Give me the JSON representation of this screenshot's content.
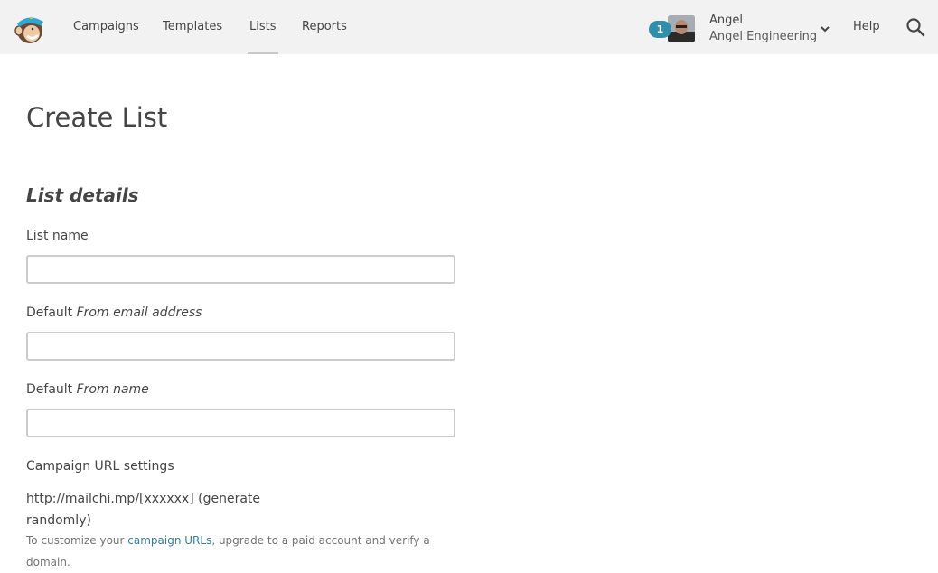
{
  "header": {
    "logo": "mailchimp-freddie-logo",
    "nav": [
      {
        "label": "Campaigns",
        "active": false
      },
      {
        "label": "Templates",
        "active": false
      },
      {
        "label": "Lists",
        "active": true
      },
      {
        "label": "Reports",
        "active": false
      }
    ],
    "notification_count": "1",
    "user": {
      "name": "Angel",
      "organization": "Angel Engineering"
    },
    "help_label": "Help",
    "icons": {
      "chevron": "chevron-down-icon",
      "search": "search-icon"
    }
  },
  "page": {
    "title": "Create List",
    "section_title": "List details"
  },
  "form": {
    "list_name": {
      "label": "List name",
      "value": "",
      "placeholder": ""
    },
    "from_email": {
      "label_prefix": "Default ",
      "label_em": "From email address",
      "value": "",
      "placeholder": ""
    },
    "from_name": {
      "label_prefix": "Default ",
      "label_em": "From name",
      "value": "",
      "placeholder": ""
    },
    "campaign_url": {
      "label": "Campaign URL settings",
      "value": "http://mailchi.mp/[xxxxxx] (generate randomly)",
      "help_prefix": "To customize your ",
      "help_link": "campaign URLs",
      "help_suffix": ", upgrade to a paid account and verify a domain."
    }
  },
  "colors": {
    "header_bg": "#f2f2f2",
    "badge": "#2f8ea9",
    "link": "#2f7f98",
    "text": "#454545"
  }
}
